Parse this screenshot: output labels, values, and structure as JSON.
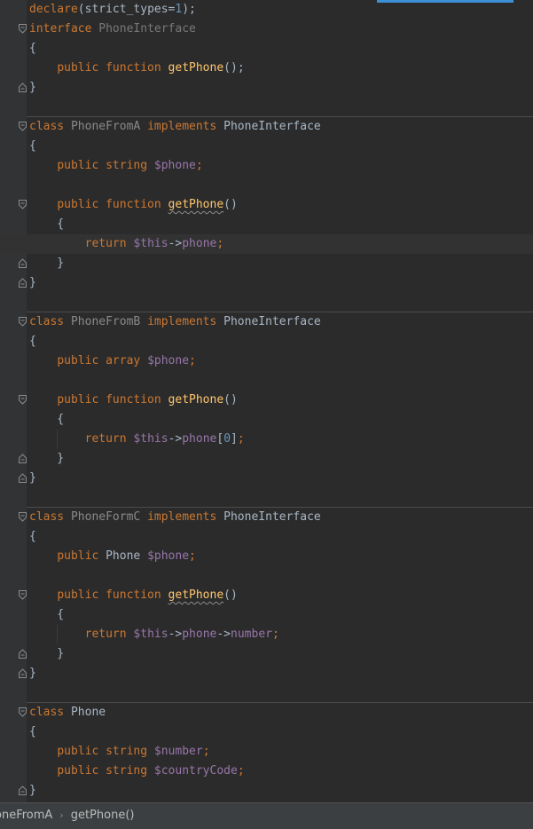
{
  "editor": {
    "lines": [
      {
        "folds": "",
        "segs": [
          [
            "kw",
            "declare"
          ],
          [
            "br",
            "(strict_types="
          ],
          [
            "num",
            "1"
          ],
          [
            "br",
            ");"
          ]
        ]
      },
      {
        "folds": "open",
        "segs": [
          [
            "kw",
            "interface "
          ],
          [
            "iface-dim",
            "PhoneInterface"
          ]
        ]
      },
      {
        "folds": "",
        "segs": [
          [
            "br",
            "{"
          ]
        ]
      },
      {
        "folds": "",
        "segs": [
          [
            "br",
            "    "
          ],
          [
            "kw",
            "public function "
          ],
          [
            "fn",
            "getPhone"
          ],
          [
            "br",
            "();"
          ]
        ]
      },
      {
        "folds": "close",
        "segs": [
          [
            "br",
            "}"
          ]
        ]
      },
      {
        "folds": "",
        "segs": []
      },
      {
        "folds": "open",
        "sep": true,
        "segs": [
          [
            "kw",
            "class "
          ],
          [
            "cls-dim",
            "PhoneFromA "
          ],
          [
            "kw",
            "implements "
          ],
          [
            "cls",
            "PhoneInterface"
          ]
        ]
      },
      {
        "folds": "",
        "segs": [
          [
            "br",
            "{"
          ]
        ]
      },
      {
        "folds": "",
        "segs": [
          [
            "br",
            "    "
          ],
          [
            "kw",
            "public string "
          ],
          [
            "var",
            "$phone"
          ],
          [
            "kw",
            ";"
          ]
        ]
      },
      {
        "folds": "",
        "segs": []
      },
      {
        "folds": "open",
        "segs": [
          [
            "br",
            "    "
          ],
          [
            "kw",
            "public function "
          ],
          [
            "fn squig",
            "getPhone"
          ],
          [
            "br",
            "()"
          ]
        ]
      },
      {
        "folds": "",
        "segs": [
          [
            "br",
            "    {"
          ]
        ]
      },
      {
        "folds": "",
        "current": true,
        "segs": [
          [
            "br",
            "        "
          ],
          [
            "kw",
            "return "
          ],
          [
            "var",
            "$this"
          ],
          [
            "br",
            "->"
          ],
          [
            "var",
            "phone"
          ],
          [
            "kw",
            ";"
          ]
        ]
      },
      {
        "folds": "close",
        "segs": [
          [
            "br",
            "    }"
          ]
        ]
      },
      {
        "folds": "close",
        "segs": [
          [
            "br",
            "}"
          ]
        ]
      },
      {
        "folds": "",
        "segs": []
      },
      {
        "folds": "open",
        "sep": true,
        "segs": [
          [
            "kw",
            "class "
          ],
          [
            "cls-dim",
            "PhoneFromB "
          ],
          [
            "kw",
            "implements "
          ],
          [
            "cls",
            "PhoneInterface"
          ]
        ]
      },
      {
        "folds": "",
        "segs": [
          [
            "br",
            "{"
          ]
        ]
      },
      {
        "folds": "",
        "segs": [
          [
            "br",
            "    "
          ],
          [
            "kw",
            "public array "
          ],
          [
            "var",
            "$phone"
          ],
          [
            "kw",
            ";"
          ]
        ]
      },
      {
        "folds": "",
        "segs": []
      },
      {
        "folds": "open",
        "segs": [
          [
            "br",
            "    "
          ],
          [
            "kw",
            "public function "
          ],
          [
            "fn",
            "getPhone"
          ],
          [
            "br",
            "()"
          ]
        ]
      },
      {
        "folds": "",
        "segs": [
          [
            "br",
            "    {"
          ]
        ]
      },
      {
        "folds": "",
        "segs": [
          [
            "br",
            "        "
          ],
          [
            "kw",
            "return "
          ],
          [
            "var",
            "$this"
          ],
          [
            "br",
            "->"
          ],
          [
            "var",
            "phone"
          ],
          [
            "br",
            "["
          ],
          [
            "num",
            "0"
          ],
          [
            "br",
            "]"
          ],
          [
            "kw",
            ";"
          ]
        ]
      },
      {
        "folds": "close",
        "segs": [
          [
            "br",
            "    }"
          ]
        ]
      },
      {
        "folds": "close",
        "segs": [
          [
            "br",
            "}"
          ]
        ]
      },
      {
        "folds": "",
        "segs": []
      },
      {
        "folds": "open",
        "sep": true,
        "segs": [
          [
            "kw",
            "class "
          ],
          [
            "cls-dim",
            "PhoneFormC "
          ],
          [
            "kw",
            "implements "
          ],
          [
            "cls",
            "PhoneInterface"
          ]
        ]
      },
      {
        "folds": "",
        "segs": [
          [
            "br",
            "{"
          ]
        ]
      },
      {
        "folds": "",
        "segs": [
          [
            "br",
            "    "
          ],
          [
            "kw",
            "public "
          ],
          [
            "cls",
            "Phone "
          ],
          [
            "var",
            "$phone"
          ],
          [
            "kw",
            ";"
          ]
        ]
      },
      {
        "folds": "",
        "segs": []
      },
      {
        "folds": "open",
        "segs": [
          [
            "br",
            "    "
          ],
          [
            "kw",
            "public function "
          ],
          [
            "fn squig",
            "getPhone"
          ],
          [
            "br",
            "()"
          ]
        ]
      },
      {
        "folds": "",
        "segs": [
          [
            "br",
            "    {"
          ]
        ]
      },
      {
        "folds": "",
        "segs": [
          [
            "br",
            "        "
          ],
          [
            "kw",
            "return "
          ],
          [
            "var",
            "$this"
          ],
          [
            "br",
            "->"
          ],
          [
            "var",
            "phone"
          ],
          [
            "br",
            "->"
          ],
          [
            "var",
            "number"
          ],
          [
            "kw",
            ";"
          ]
        ]
      },
      {
        "folds": "close",
        "segs": [
          [
            "br",
            "    }"
          ]
        ]
      },
      {
        "folds": "close",
        "segs": [
          [
            "br",
            "}"
          ]
        ]
      },
      {
        "folds": "",
        "segs": []
      },
      {
        "folds": "open",
        "sep": true,
        "segs": [
          [
            "kw",
            "class "
          ],
          [
            "cls",
            "Phone"
          ]
        ]
      },
      {
        "folds": "",
        "segs": [
          [
            "br",
            "{"
          ]
        ]
      },
      {
        "folds": "",
        "segs": [
          [
            "br",
            "    "
          ],
          [
            "kw",
            "public string "
          ],
          [
            "var",
            "$number"
          ],
          [
            "kw",
            ";"
          ]
        ]
      },
      {
        "folds": "",
        "segs": [
          [
            "br",
            "    "
          ],
          [
            "kw",
            "public string "
          ],
          [
            "var",
            "$countryCode"
          ],
          [
            "kw",
            ";"
          ]
        ]
      },
      {
        "folds": "close",
        "segs": [
          [
            "br",
            "}"
          ]
        ]
      }
    ]
  },
  "breadcrumb": {
    "items": [
      "oneFromA",
      "getPhone()"
    ],
    "separator": "›"
  },
  "colors": {
    "background": "#2b2b2b",
    "keyword": "#cc7832",
    "function": "#ffc66d",
    "variable": "#9876aa",
    "number": "#6897bb",
    "accent": "#3d8fd6"
  }
}
